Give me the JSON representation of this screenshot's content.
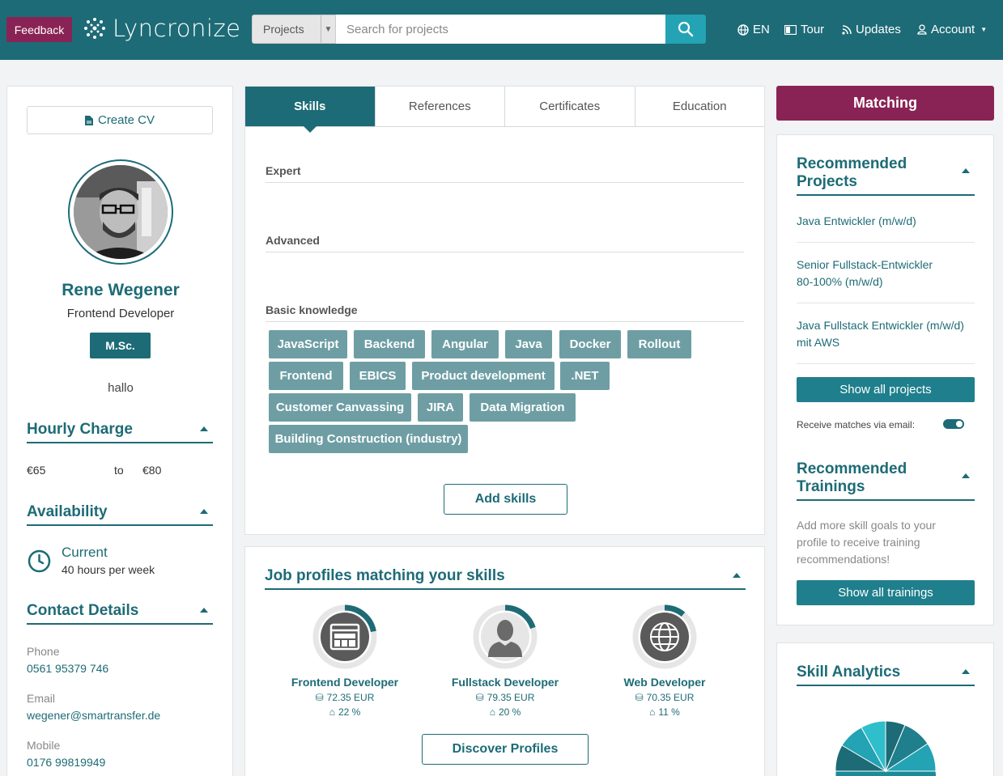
{
  "header": {
    "feedback": "Feedback",
    "logo": "Lyncronize",
    "search_category": "Projects",
    "search_placeholder": "Search for projects",
    "nav": {
      "lang": "EN",
      "tour": "Tour",
      "updates": "Updates",
      "account": "Account"
    }
  },
  "profile": {
    "create_cv": "Create CV",
    "name": "Rene Wegener",
    "role": "Frontend Developer",
    "degree": "M.Sc.",
    "bio": "hallo"
  },
  "hourly": {
    "title": "Hourly Charge",
    "from": "€65",
    "to_label": "to",
    "to": "€80"
  },
  "availability": {
    "title": "Availability",
    "status": "Current",
    "hours": "40 hours per week"
  },
  "contact": {
    "title": "Contact Details",
    "phone_label": "Phone",
    "phone": "0561 95379 746",
    "email_label": "Email",
    "email": "wegener@smartransfer.de",
    "mobile_label": "Mobile",
    "mobile": "0176 99819949"
  },
  "tabs": [
    "Skills",
    "References",
    "Certificates",
    "Education"
  ],
  "skills": {
    "expert": "Expert",
    "advanced": "Advanced",
    "basic": "Basic knowledge",
    "chips": [
      "JavaScript",
      "Backend",
      "Angular",
      "Java",
      "Docker",
      "Rollout",
      "Frontend",
      "EBICS",
      "Product development",
      ".NET",
      "Customer Canvassing",
      "JIRA",
      "Data Migration",
      "Building Construction (industry)"
    ],
    "add": "Add skills"
  },
  "job_profiles": {
    "title": "Job profiles matching your skills",
    "items": [
      {
        "name": "Frontend Developer",
        "salary": "72.35 EUR",
        "percent": "22 %",
        "fraction": 0.22
      },
      {
        "name": "Fullstack Developer",
        "salary": "79.35 EUR",
        "percent": "20 %",
        "fraction": 0.2
      },
      {
        "name": "Web Developer",
        "salary": "70.35 EUR",
        "percent": "11 %",
        "fraction": 0.11
      }
    ],
    "discover": "Discover Profiles"
  },
  "matching": "Matching",
  "recommended_projects": {
    "title_line1": "Recommended",
    "title_line2": "Projects",
    "items": [
      [
        "Java Entwickler (m/w/d)"
      ],
      [
        "Senior Fullstack-Entwickler",
        "80-100% (m/w/d)"
      ],
      [
        "Java Fullstack Entwickler (m/w/d)",
        "mit AWS"
      ]
    ],
    "show_all": "Show all projects",
    "email_toggle": "Receive matches via email:"
  },
  "recommended_trainings": {
    "title_line1": "Recommended",
    "title_line2": "Trainings",
    "text": [
      "Add more skill goals to your",
      "profile to receive training",
      "recommendations!"
    ],
    "show_all": "Show all trainings"
  },
  "skill_analytics": {
    "title": "Skill Analytics"
  },
  "colors": {
    "primary": "#1d6b76",
    "accent": "#8a2355",
    "chip": "#6e9ea4",
    "search_btn": "#23a3b3"
  }
}
